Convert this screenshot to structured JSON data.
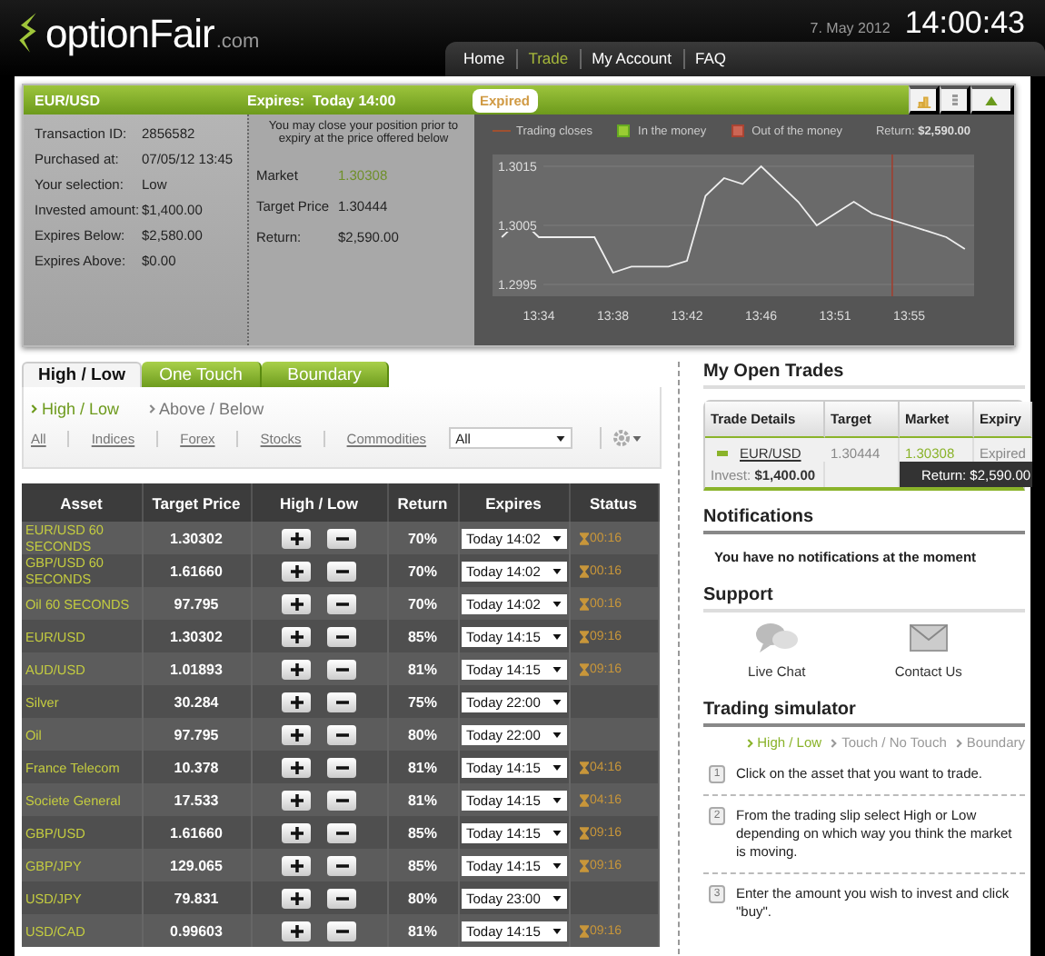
{
  "logo": {
    "name": "optionFair",
    "suffix": ".com"
  },
  "date": "7. May 2012",
  "clock": "14:00:43",
  "nav": [
    {
      "label": "Home",
      "selected": false
    },
    {
      "label": "Trade",
      "selected": true
    },
    {
      "label": "My Account",
      "selected": false
    },
    {
      "label": "FAQ",
      "selected": false
    }
  ],
  "trade": {
    "pair": "EUR/USD",
    "expires": "Expires:  Today 14:00",
    "status": "Expired",
    "details": [
      {
        "label": "Transaction ID:",
        "value": "2856582"
      },
      {
        "label": "Purchased at:",
        "value": "07/05/12 13:45"
      },
      {
        "label": "Your selection:",
        "value": "Low"
      },
      {
        "label": "Invested amount:",
        "value": "$1,400.00"
      },
      {
        "label": "Expires Below:",
        "value": "$2,580.00"
      },
      {
        "label": "Expires Above:",
        "value": "$0.00"
      }
    ],
    "close_note": "You may close your position prior to expiry at the price offered below",
    "offer": [
      {
        "label": "Market",
        "value": "1.30308",
        "kind": "market"
      },
      {
        "label": "Target Price",
        "value": "1.30444",
        "kind": "plain"
      },
      {
        "label": "Return:",
        "value": "$2,590.00",
        "kind": "plain"
      }
    ],
    "chart": {
      "legend": [
        {
          "label": "Trading closes",
          "kind": "line"
        },
        {
          "label": "In the money",
          "kind": "green"
        },
        {
          "label": "Out of the money",
          "kind": "red"
        }
      ],
      "return": "Return: **$2,590.00**",
      "chart_data": {
        "type": "line",
        "categories": [
          null,
          null,
          "13:34",
          null,
          null,
          null,
          "13:38",
          null,
          null,
          null,
          "13:42",
          null,
          null,
          null,
          "13:46",
          null,
          null,
          null,
          "13:51",
          null,
          null,
          null,
          "13:55",
          null,
          null,
          null
        ],
        "series": [
          {
            "color": "#eeeeee",
            "values": [
              1.3003,
              1.3006,
              1.3003,
              1.3003,
              1.3003,
              1.3003,
              1.2997,
              1.2998,
              1.2998,
              1.2998,
              1.2999,
              1.301,
              1.3013,
              1.3012,
              1.3015,
              1.3012,
              1.3009,
              1.3005,
              1.3007,
              1.3009,
              1.3007,
              1.3006,
              1.3005,
              1.3004,
              1.3003,
              1.3001
            ]
          }
        ],
        "ylim": [
          1.2993,
          1.3017
        ],
        "yticks": [
          1.3015,
          1.3005,
          1.2995
        ],
        "grid": true
      }
    }
  },
  "product_tabs": [
    {
      "label": "High / Low",
      "selected": true
    },
    {
      "label": "One Touch",
      "selected": false
    },
    {
      "label": "Boundary",
      "selected": false
    }
  ],
  "sub_tabs": [
    {
      "label": "High / Low",
      "selected": true
    },
    {
      "label": "Above / Below",
      "selected": false
    }
  ],
  "filters": [
    "All",
    "Indices",
    "Forex",
    "Stocks",
    "Commodities"
  ],
  "filter_select": "All",
  "columns": [
    "Asset",
    "Target Price",
    "High / Low",
    "Return",
    "Expires",
    "Status"
  ],
  "rows": [
    {
      "asset": "EUR/USD 60 SECONDS",
      "target": "1.30302",
      "return": "70%",
      "expires": "Today 14:02",
      "status": "00:16"
    },
    {
      "asset": "GBP/USD 60 SECONDS",
      "target": "1.61660",
      "return": "70%",
      "expires": "Today 14:02",
      "status": "00:16"
    },
    {
      "asset": "Oil 60 SECONDS",
      "target": "97.795",
      "return": "70%",
      "expires": "Today 14:02",
      "status": "00:16"
    },
    {
      "asset": "EUR/USD",
      "target": "1.30302",
      "return": "85%",
      "expires": "Today 14:15",
      "status": "09:16"
    },
    {
      "asset": "AUD/USD",
      "target": "1.01893",
      "return": "81%",
      "expires": "Today 14:15",
      "status": "09:16"
    },
    {
      "asset": "Silver",
      "target": "30.284",
      "return": "75%",
      "expires": "Today 22:00"
    },
    {
      "asset": "Oil",
      "target": "97.795",
      "return": "80%",
      "expires": "Today 22:00"
    },
    {
      "asset": "France Telecom",
      "target": "10.378",
      "return": "81%",
      "expires": "Today 14:15",
      "status": "04:16"
    },
    {
      "asset": "Societe General",
      "target": "17.533",
      "return": "81%",
      "expires": "Today 14:15",
      "status": "04:16"
    },
    {
      "asset": "GBP/USD",
      "target": "1.61660",
      "return": "85%",
      "expires": "Today 14:15",
      "status": "09:16"
    },
    {
      "asset": "GBP/JPY",
      "target": "129.065",
      "return": "85%",
      "expires": "Today 14:15",
      "status": "09:16"
    },
    {
      "asset": "USD/JPY",
      "target": "79.831",
      "return": "80%",
      "expires": "Today 23:00"
    },
    {
      "asset": "USD/CAD",
      "target": "0.99603",
      "return": "81%",
      "expires": "Today 14:15",
      "status": "09:16"
    }
  ],
  "open_trades": {
    "title": "My Open Trades",
    "columns": [
      "Trade Details",
      "Target",
      "Market",
      "Expiry"
    ],
    "rows": [
      {
        "asset": "EUR/USD",
        "invest": "Invest: **$1,400.00**",
        "target": "1.30444",
        "market": "1.30308",
        "expiry": "Expired",
        "return": "Return: $2,590.00"
      }
    ]
  },
  "notifications": {
    "title": "Notifications",
    "message": "You have no notifications at the moment"
  },
  "support": {
    "title": "Support",
    "items": [
      {
        "label": "Live Chat",
        "kind": "chat"
      },
      {
        "label": "Contact Us",
        "kind": "mail"
      }
    ]
  },
  "simulator": {
    "title": "Trading simulator",
    "tabs": [
      {
        "label": "High / Low",
        "selected": true
      },
      {
        "label": "Touch / No Touch",
        "selected": false
      },
      {
        "label": "Boundary",
        "selected": false
      }
    ],
    "steps": [
      {
        "number": "1",
        "text": "Click on the asset that you want to trade."
      },
      {
        "number": "2",
        "text": "From the trading slip select High or  Low depending on which way you think the market is moving."
      },
      {
        "number": "3",
        "text": "Enter the amount you wish to invest and click \"buy\"."
      }
    ]
  }
}
